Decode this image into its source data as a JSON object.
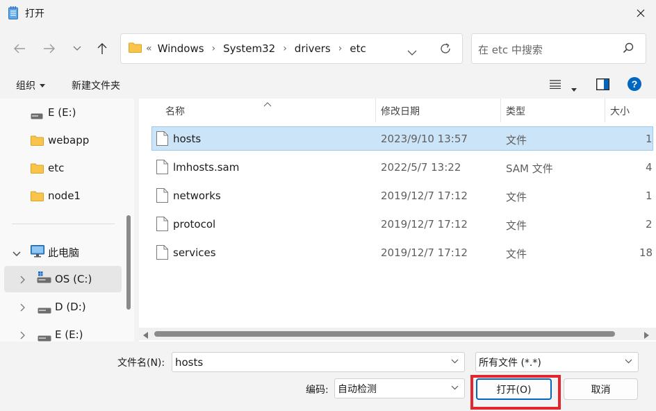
{
  "window": {
    "title": "打开"
  },
  "address": {
    "lead": "«",
    "crumbs": [
      "Windows",
      "System32",
      "drivers",
      "etc"
    ]
  },
  "search": {
    "placeholder": "在 etc 中搜索"
  },
  "toolbar": {
    "organize_label": "组织",
    "new_folder_label": "新建文件夹"
  },
  "nav": {
    "items": [
      {
        "label": "E (E:)",
        "icon": "drive-icon"
      },
      {
        "label": "webapp",
        "icon": "folder-icon"
      },
      {
        "label": "etc",
        "icon": "folder-icon"
      },
      {
        "label": "node1",
        "icon": "folder-icon"
      },
      {
        "label": "此电脑",
        "icon": "computer-icon"
      },
      {
        "label": "OS (C:)",
        "icon": "os-drive-icon"
      },
      {
        "label": "D (D:)",
        "icon": "drive-icon"
      },
      {
        "label": "E (E:)",
        "icon": "drive-icon"
      }
    ]
  },
  "columns": {
    "name": "名称",
    "modified": "修改日期",
    "type": "类型",
    "size": "大小"
  },
  "files": [
    {
      "name": "hosts",
      "modified": "2023/9/10 13:57",
      "type": "文件",
      "size": "1"
    },
    {
      "name": "lmhosts.sam",
      "modified": "2022/5/7 13:22",
      "type": "SAM 文件",
      "size": "4"
    },
    {
      "name": "networks",
      "modified": "2019/12/7 17:12",
      "type": "文件",
      "size": "1"
    },
    {
      "name": "protocol",
      "modified": "2019/12/7 17:12",
      "type": "文件",
      "size": "2"
    },
    {
      "name": "services",
      "modified": "2019/12/7 17:12",
      "type": "文件",
      "size": "18"
    }
  ],
  "bottom": {
    "filename_label": "文件名(N):",
    "filename_value": "hosts",
    "filetype_value": "所有文件  (*.*)",
    "encoding_label": "编码:",
    "encoding_value": "自动检测",
    "open_label": "打开(O)",
    "cancel_label": "取消"
  },
  "colors": {
    "accent": "#0067c0",
    "selection": "#cce4f7",
    "highlight": "#e3262e",
    "folder": "#f8c54a"
  }
}
